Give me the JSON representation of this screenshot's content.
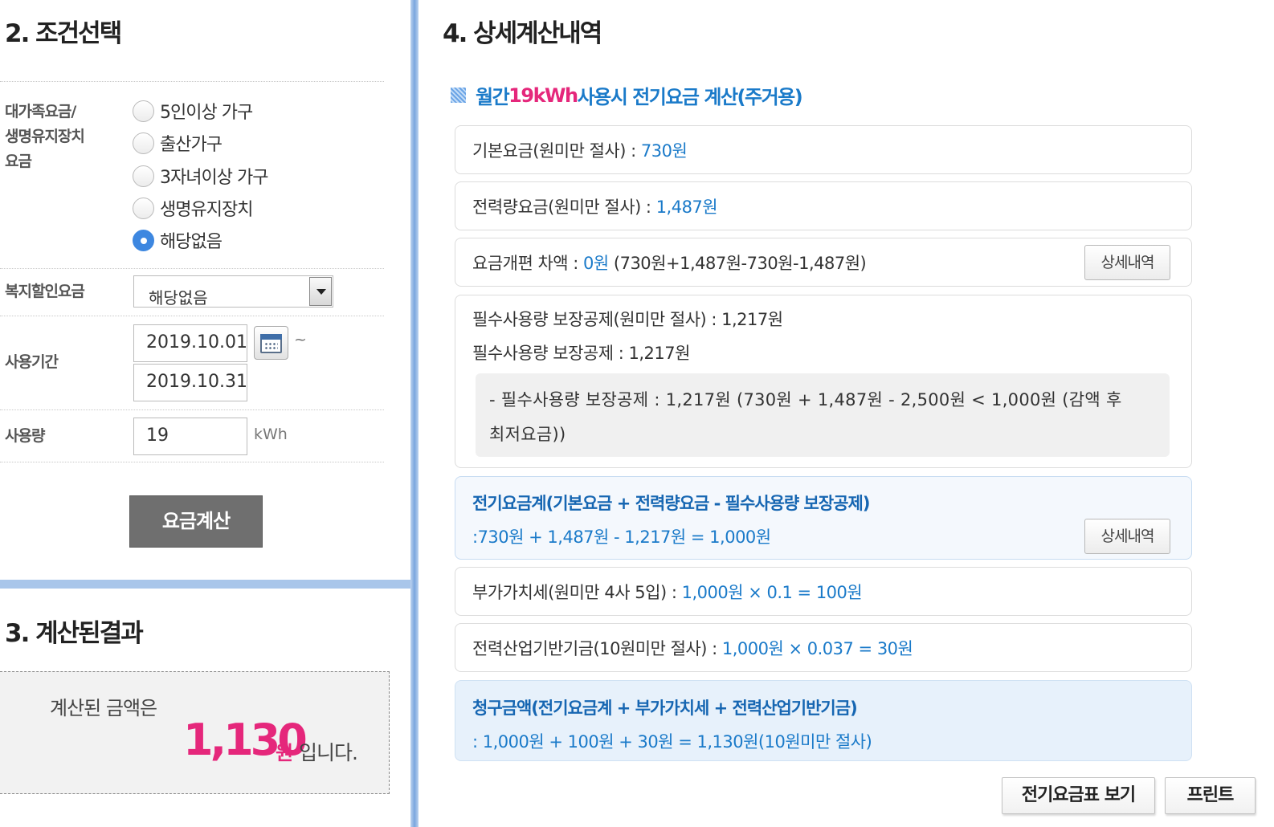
{
  "section2": {
    "title": "2. 조건선택",
    "family": {
      "label_lines": [
        "대가족요금/",
        "생명유지장치",
        "요금"
      ],
      "options": [
        {
          "label": "5인이상 가구",
          "checked": false
        },
        {
          "label": "출산가구",
          "checked": false
        },
        {
          "label": "3자녀이상 가구",
          "checked": false
        },
        {
          "label": "생명유지장치",
          "checked": false
        },
        {
          "label": "해당없음",
          "checked": true
        }
      ]
    },
    "welfare": {
      "label": "복지할인요금",
      "selected": "해당없음"
    },
    "period": {
      "label": "사용기간",
      "start": "2019.10.01",
      "end": "2019.10.31",
      "separator": "~"
    },
    "usage": {
      "label": "사용량",
      "value": "19",
      "unit": "kWh"
    },
    "calc_button": "요금계산"
  },
  "section3": {
    "title": "3. 계산된결과",
    "prefix": "계산된 금액은",
    "amount": "1,130",
    "unit": "원",
    "suffix": "입니다."
  },
  "section4": {
    "title": "4. 상세계산내역",
    "subtitle": {
      "pre": "월간 ",
      "usage": "19kWh",
      "post": " 사용시 전기요금 계산(주거용)"
    },
    "base_fee": {
      "label": "기본요금(원미만 절사) : ",
      "value": "730원"
    },
    "energy_fee": {
      "label": "전력량요금(원미만 절사) : ",
      "value": "1,487원"
    },
    "reform_diff": {
      "label": "요금개편 차액 : ",
      "value": "0원",
      "formula": " (730원+1,487원-730원-1,487원)",
      "button": "상세내역"
    },
    "guarantee": {
      "line1": "필수사용량 보장공제(원미만 절사) : 1,217원",
      "line2": "필수사용량 보장공제 : 1,217원",
      "detail_line1": "- 필수사용량 보장공제 : 1,217원 (730원 + 1,487원 - 2,500원 < 1,000원 (감액 후",
      "detail_line2": "최저요금))"
    },
    "total": {
      "line1": "전기요금계(기본요금 + 전력량요금 - 필수사용량 보장공제)",
      "line2": ":730원 + 1,487원 - 1,217원 = 1,000원",
      "button": "상세내역"
    },
    "vat": {
      "label": "부가가치세(원미만 4사 5입) : ",
      "value": "1,000원 × 0.1 = 100원"
    },
    "fund": {
      "label": "전력산업기반기금(10원미만 절사) : ",
      "value": "1,000원 × 0.037 = 30원"
    },
    "bill": {
      "line1": "청구금액(전기요금계 + 부가가치세 + 전력산업기반기금)",
      "line2": ": 1,000원 + 100원 + 30원 = 1,130원(10원미만 절사)"
    },
    "buttons": {
      "rate_table": "전기요금표 보기",
      "print": "프린트"
    }
  },
  "colors": {
    "accent_blue": "#1a7ac9",
    "pink": "#e5277b",
    "divider_blue": "#a9c6ea",
    "calc_button": "#6f6f6f"
  }
}
